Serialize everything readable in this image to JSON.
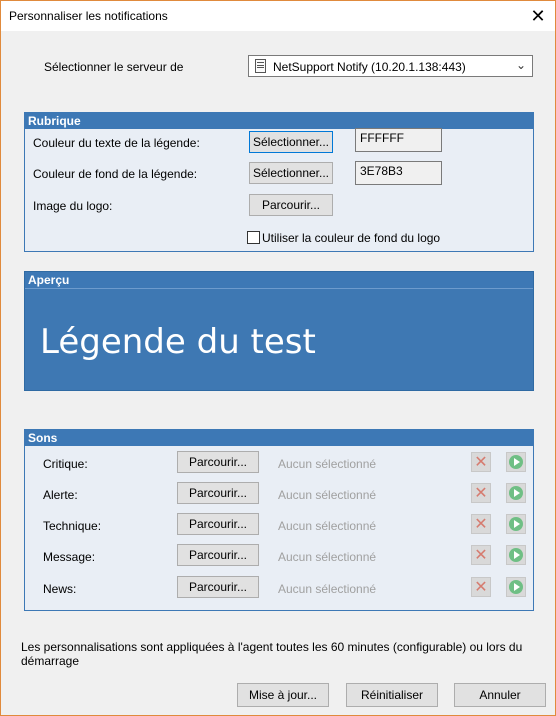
{
  "window": {
    "title": "Personnaliser les notifications",
    "close_glyph": "✕"
  },
  "server": {
    "label": "Sélectionner le serveur de",
    "selected": "NetSupport Notify (10.20.1.138:443)",
    "icon": "server-icon"
  },
  "rubrique": {
    "header": "Rubrique",
    "text_color_label": "Couleur du texte de la légende:",
    "text_color_button": "Sélectionner...",
    "text_color_value": "FFFFFF",
    "bg_color_label": "Couleur de fond de la légende:",
    "bg_color_button": "Sélectionner...",
    "bg_color_value": "3E78B3",
    "logo_label": "Image du logo:",
    "logo_button": "Parcourir...",
    "use_logo_bg_label": "Utiliser la couleur de fond du logo",
    "use_logo_bg_checked": false
  },
  "preview": {
    "header": "Aperçu",
    "caption": "Légende du test",
    "bg_color": "#3E78B3",
    "text_color": "#FFFFFF"
  },
  "sons": {
    "header": "Sons",
    "rows": [
      {
        "label": "Critique:",
        "button": "Parcourir...",
        "value": "Aucun sélectionné"
      },
      {
        "label": "Alerte:",
        "button": "Parcourir...",
        "value": "Aucun sélectionné"
      },
      {
        "label": "Technique:",
        "button": "Parcourir...",
        "value": "Aucun sélectionné"
      },
      {
        "label": "Message:",
        "button": "Parcourir...",
        "value": "Aucun sélectionné"
      },
      {
        "label": "News:",
        "button": "Parcourir...",
        "value": "Aucun sélectionné"
      }
    ]
  },
  "footer": {
    "note": "Les personnalisations sont appliquées à l'agent toutes les 60 minutes (configurable) ou lors du démarrage",
    "update_button": "Mise à jour...",
    "reset_button": "Réinitialiser",
    "cancel_button": "Annuler"
  }
}
